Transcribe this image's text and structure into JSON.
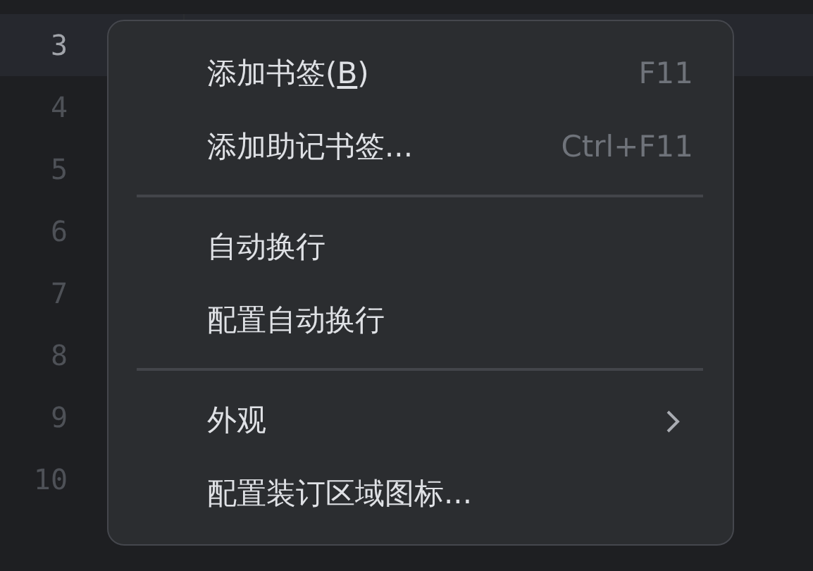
{
  "editor": {
    "lines": [
      {
        "number": "3",
        "current": true
      },
      {
        "number": "4",
        "current": false
      },
      {
        "number": "5",
        "current": false
      },
      {
        "number": "6",
        "current": false
      },
      {
        "number": "7",
        "current": false
      },
      {
        "number": "8",
        "current": false
      },
      {
        "number": "9",
        "current": false
      },
      {
        "number": "10",
        "current": false
      }
    ]
  },
  "context_menu": {
    "items": [
      {
        "kind": "item",
        "label": "添加书签(",
        "mnemonic": "B",
        "label_end": ")",
        "shortcut": "F11"
      },
      {
        "kind": "item",
        "label": "添加助记书签...",
        "shortcut": "Ctrl+F11"
      },
      {
        "kind": "separator"
      },
      {
        "kind": "item",
        "label": "自动换行"
      },
      {
        "kind": "item",
        "label": "配置自动换行"
      },
      {
        "kind": "separator"
      },
      {
        "kind": "submenu",
        "label": "外观"
      },
      {
        "kind": "item",
        "label": "配置装订区域图标..."
      }
    ]
  }
}
